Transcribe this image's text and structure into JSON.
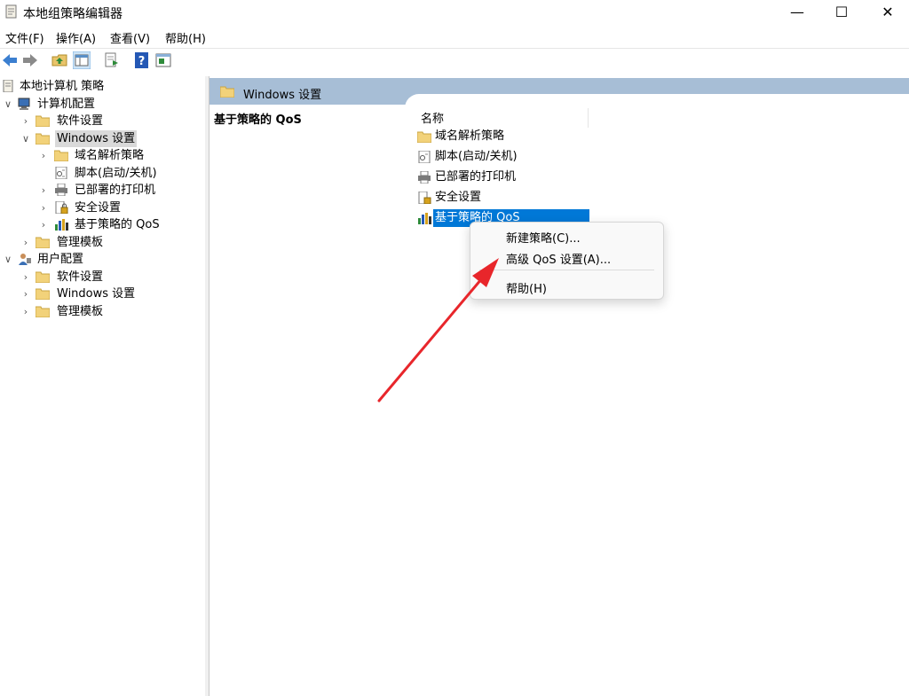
{
  "window": {
    "title": "本地组策略编辑器",
    "minimize": "—",
    "maximize": "☐",
    "close": "✕"
  },
  "menu": {
    "items": [
      "文件(F)",
      "操作(A)",
      "查看(V)",
      "帮助(H)"
    ]
  },
  "tree": {
    "root": "本地计算机 策略",
    "computer_config": "计算机配置",
    "cc_software": "软件设置",
    "cc_windows": "Windows 设置",
    "cc_win_dns": "域名解析策略",
    "cc_win_scripts": "脚本(启动/关机)",
    "cc_win_printers": "已部署的打印机",
    "cc_win_security": "安全设置",
    "cc_win_qos": "基于策略的 QoS",
    "cc_admin_templates": "管理模板",
    "user_config": "用户配置",
    "uc_software": "软件设置",
    "uc_windows": "Windows 设置",
    "uc_admin_templates": "管理模板"
  },
  "right": {
    "header_title": "Windows 设置",
    "left_description": "基于策略的 QoS",
    "column_name": "名称",
    "items": [
      "域名解析策略",
      "脚本(启动/关机)",
      "已部署的打印机",
      "安全设置",
      "基于策略的 QoS"
    ]
  },
  "context_menu": {
    "new_policy": "新建策略(C)...",
    "advanced_qos": "高级 QoS 设置(A)...",
    "help": "帮助(H)"
  },
  "colors": {
    "selection": "#0078d7",
    "header_band": "#a7bed6",
    "annotation_arrow": "#e8262b"
  }
}
